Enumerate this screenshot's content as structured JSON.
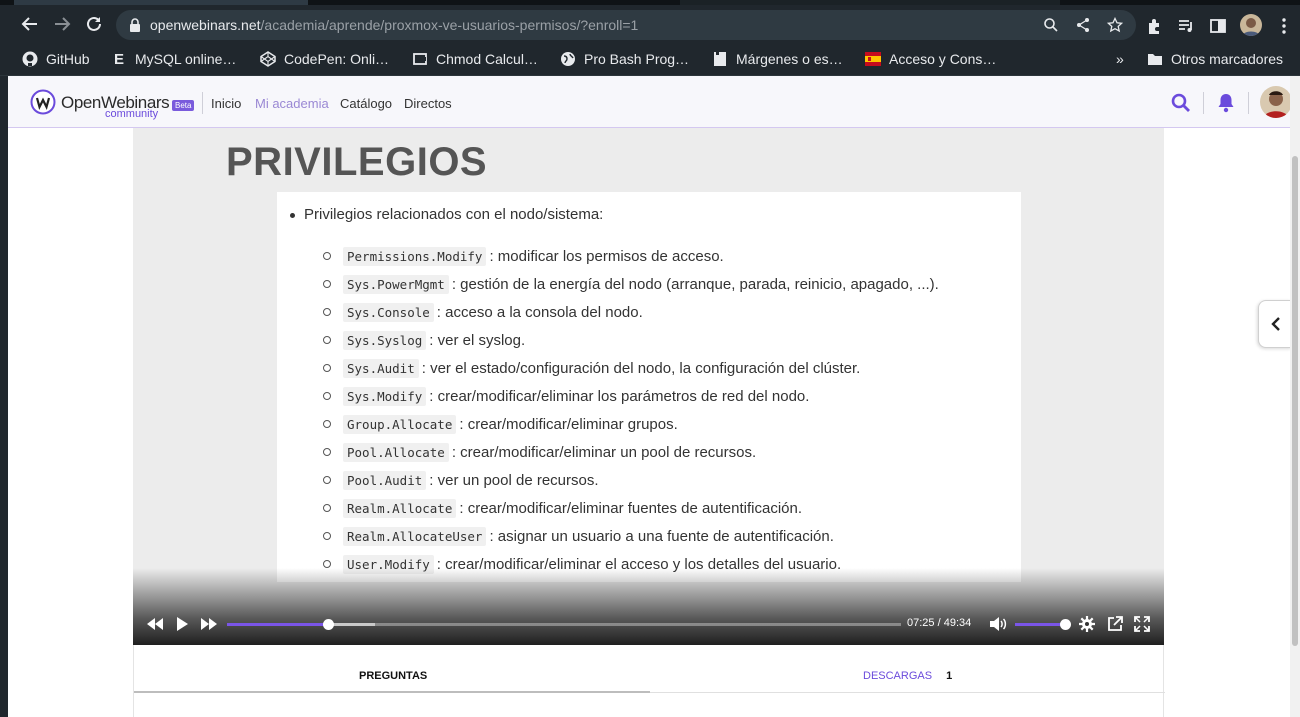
{
  "browser": {
    "url_domain": "openwebinars.net",
    "url_path": "/academia/aprende/proxmox-ve-usuarios-permisos/?enroll=1",
    "bookmarks": [
      {
        "label": "GitHub",
        "icon": "github-icon"
      },
      {
        "label": "MySQL online…",
        "icon": "e-letter-icon"
      },
      {
        "label": "CodePen: Onli…",
        "icon": "codepen-icon"
      },
      {
        "label": "Chmod Calcul…",
        "icon": "chmod-icon"
      },
      {
        "label": "Pro Bash Prog…",
        "icon": "globe-icon"
      },
      {
        "label": "Márgenes o es…",
        "icon": "page-icon"
      },
      {
        "label": "Acceso y Cons…",
        "icon": "spain-flag-icon"
      }
    ],
    "more_bookmarks": "»",
    "other_bookmarks": "Otros marcadores"
  },
  "site": {
    "logo_text": "OpenWebinars",
    "logo_sub": "community",
    "beta": "Beta",
    "nav": [
      "Inicio",
      "Mi academia",
      "Catálogo",
      "Directos"
    ],
    "active_nav": "Mi academia",
    "accent": "#6b4bdc"
  },
  "slide": {
    "title": "PRIVILEGIOS",
    "main_bullet": "Privilegios relacionados con el nodo/sistema:",
    "items": [
      {
        "code": "Permissions.Modify",
        "text": ": modificar los permisos de acceso."
      },
      {
        "code": "Sys.PowerMgmt",
        "text": ": gestión de la energía del nodo (arranque, parada, reinicio, apagado, ...)."
      },
      {
        "code": "Sys.Console",
        "text": ": acceso a la consola del nodo."
      },
      {
        "code": "Sys.Syslog",
        "text": ": ver el syslog."
      },
      {
        "code": "Sys.Audit",
        "text": ": ver el estado/configuración del nodo, la configuración del clúster."
      },
      {
        "code": "Sys.Modify",
        "text": ": crear/modificar/eliminar los parámetros de red del nodo."
      },
      {
        "code": "Group.Allocate",
        "text": ": crear/modificar/eliminar grupos."
      },
      {
        "code": "Pool.Allocate",
        "text": ": crear/modificar/eliminar un pool de recursos."
      },
      {
        "code": "Pool.Audit",
        "text": ": ver un pool de recursos."
      },
      {
        "code": "Realm.Allocate",
        "text": ": crear/modificar/eliminar fuentes de autentificación."
      },
      {
        "code": "Realm.AllocateUser",
        "text": ": asignar un usuario a una fuente de autentificación."
      },
      {
        "code": "User.Modify",
        "text": ": crear/modificar/eliminar el acceso y los detalles del usuario."
      }
    ]
  },
  "player": {
    "current_time": "07:25",
    "separator": "/",
    "duration": "49:34",
    "progress_fraction": 0.15,
    "buffered_fraction": 0.22,
    "volume_fraction": 1.0,
    "progress_color": "#7a55e8"
  },
  "tabs": {
    "questions": "PREGUNTAS",
    "downloads": "DESCARGAS",
    "downloads_count": "1"
  }
}
